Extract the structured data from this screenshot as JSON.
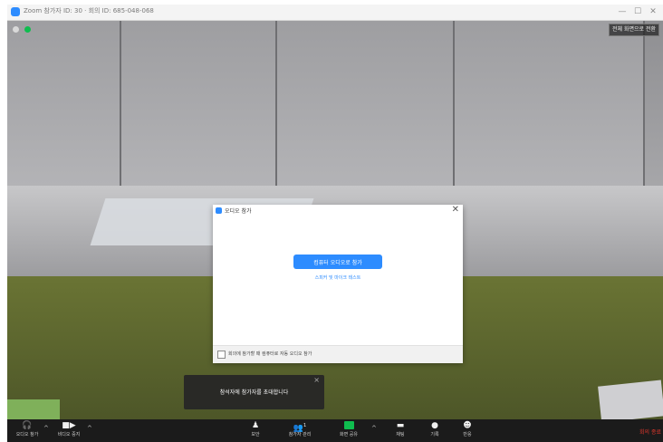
{
  "window": {
    "title": "Zoom 참가자 ID: 30 · 회의 ID: 685-048-068",
    "controls": {
      "minimize": "—",
      "maximize": "☐",
      "close": "✕"
    }
  },
  "video": {
    "fullscreen_exit": "전체 화면으로 전환"
  },
  "dialog": {
    "title": "오디오 참가",
    "join_button": "컴퓨터 오디오로 참가",
    "test_link": "스피커 및 마이크 테스트",
    "auto_join_label": "회의에 참가할 때 컴퓨터로 자동 오디오 참가",
    "auto_join_checked": false,
    "close": "✕"
  },
  "toast": {
    "text": "참석자에 참가자를 초대합니다",
    "close": "×"
  },
  "toolbar": {
    "items": [
      {
        "label": "오디오 참가",
        "icon": "headphones-icon"
      },
      {
        "label": "비디오 중지",
        "icon": "video-camera-icon"
      },
      {
        "label": "보안",
        "icon": "security-icon"
      },
      {
        "label": "참가자 관리",
        "icon": "participants-icon",
        "count": "1"
      },
      {
        "label": "화면 공유",
        "icon": "share-screen-icon"
      },
      {
        "label": "채팅",
        "icon": "chat-icon"
      },
      {
        "label": "기록",
        "icon": "record-icon"
      },
      {
        "label": "반응",
        "icon": "reactions-icon"
      }
    ],
    "end_label": "회의 종료"
  },
  "colors": {
    "accent": "#2d8cff",
    "end_red": "#e0372c",
    "share_green": "#0fbd4f",
    "toolbar_bg": "#1b1b1b"
  }
}
